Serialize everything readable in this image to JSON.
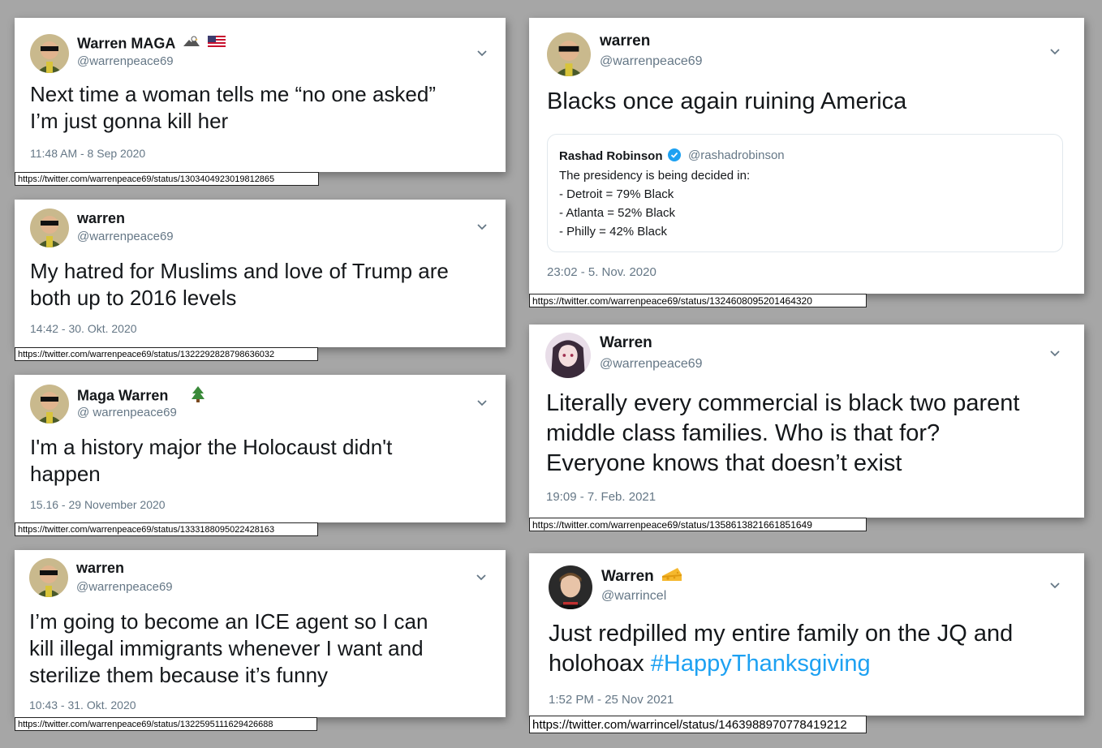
{
  "tweets": [
    {
      "name": "Warren MAGA",
      "handle": "@warrenpeace69",
      "text_line1": "Next time a woman tells me “no one asked”",
      "text_line2": "I’m just gonna kill her",
      "date": "11:48 AM - 8 Sep 2020",
      "url": "https://twitter.com/warrenpeace69/status/1303404923019812865"
    },
    {
      "name": "warren",
      "handle": "@warrenpeace69",
      "text_line1": "My hatred for Muslims and love of Trump are",
      "text_line2": "both up to 2016 levels",
      "date": "14:42 - 30. Okt. 2020",
      "url": "https://twitter.com/warrenpeace69/status/1322292828798636032"
    },
    {
      "name": "Maga Warren",
      "handle": "@ warrenpeace69",
      "text_line1": "I'm a history major the Holocaust didn't",
      "text_line2": "happen",
      "date": "15.16 - 29 November 2020",
      "url": "https://twitter.com/warrenpeace69/status/1333188095022428163"
    },
    {
      "name": "warren",
      "handle": "@warrenpeace69",
      "text_line1": "I’m going to become an ICE agent so I can",
      "text_line2": "kill illegal immigrants whenever I want and",
      "text_line3": "sterilize them because it’s funny",
      "date": "10:43 - 31. Okt. 2020",
      "url": "https://twitter.com/warrenpeace69/status/1322595111629426688"
    },
    {
      "name": "warren",
      "handle": "@warrenpeace69",
      "text_line1": "Blacks once again ruining America",
      "quote": {
        "name": "Rashad Robinson",
        "handle": "@rashadrobinson",
        "line1": "The presidency is being decided in:",
        "line2": "- Detroit = 79% Black",
        "line3": "- Atlanta = 52% Black",
        "line4": "- Philly = 42% Black"
      },
      "date": "23:02 - 5. Nov. 2020",
      "url": "https://twitter.com/warrenpeace69/status/1324608095201464320"
    },
    {
      "name": "Warren",
      "handle": "@warrenpeace69",
      "text_line1": "Literally every commercial is black two parent",
      "text_line2": "middle class families. Who is that for?",
      "text_line3": "Everyone knows that doesn’t exist",
      "date": "19:09 - 7. Feb. 2021",
      "url": "https://twitter.com/warrenpeace69/status/1358613821661851649"
    },
    {
      "name": "Warren",
      "handle": "@warrincel",
      "text_line1": "Just redpilled my entire family on the JQ and",
      "text_line2_plain": "holohoax ",
      "text_line2_hashtag": "#HappyThanksgiving",
      "date": "1:52 PM - 25 Nov 2021",
      "url": "https://twitter.com/warrincel/status/1463988970778419212"
    }
  ],
  "icons": {
    "chevron": "chevron-down-icon",
    "verified": "verified-badge-icon",
    "eagle": "eagle-emoji-icon",
    "flag": "us-flag-emoji-icon",
    "tree": "evergreen-tree-emoji-icon",
    "cheese": "cheese-emoji-icon"
  },
  "colors": {
    "background": "#a6a6a6",
    "link": "#1da1f2",
    "muted": "#657786"
  }
}
